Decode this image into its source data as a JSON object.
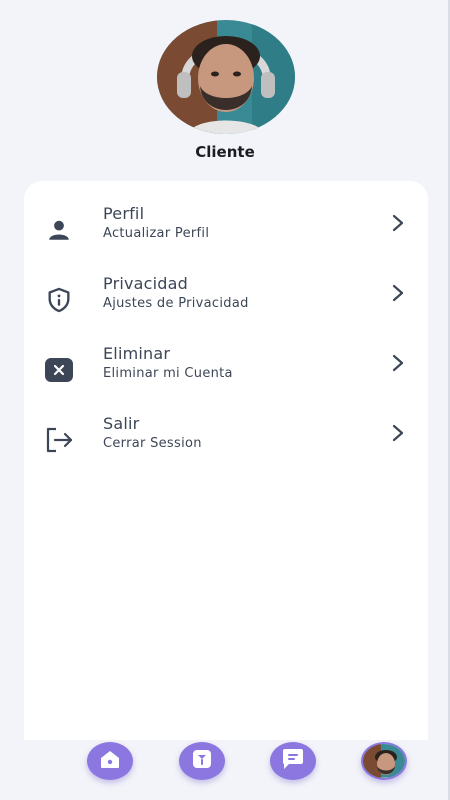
{
  "profile": {
    "name": "Cliente",
    "avatar_icon": "user-photo"
  },
  "menu": {
    "items": [
      {
        "icon": "user-icon",
        "title": "Perfil",
        "subtitle": "Actualizar Perfil"
      },
      {
        "icon": "shield-info-icon",
        "title": "Privacidad",
        "subtitle": "Ajustes de Privacidad"
      },
      {
        "icon": "close-box-icon",
        "title": "Eliminar",
        "subtitle": "Eliminar mi Cuenta"
      },
      {
        "icon": "logout-icon",
        "title": "Salir",
        "subtitle": "Cerrar Session"
      }
    ],
    "chevron_icon": "chevron-right-icon"
  },
  "bottom_nav": {
    "items": [
      {
        "icon": "home-icon"
      },
      {
        "icon": "tools-icon"
      },
      {
        "icon": "chat-icon"
      },
      {
        "icon": "profile-avatar"
      }
    ]
  },
  "colors": {
    "background": "#f2f4f9",
    "card": "#ffffff",
    "accent": "#8c77e0",
    "text_dark": "#3d4656",
    "title": "#1c1c24"
  }
}
